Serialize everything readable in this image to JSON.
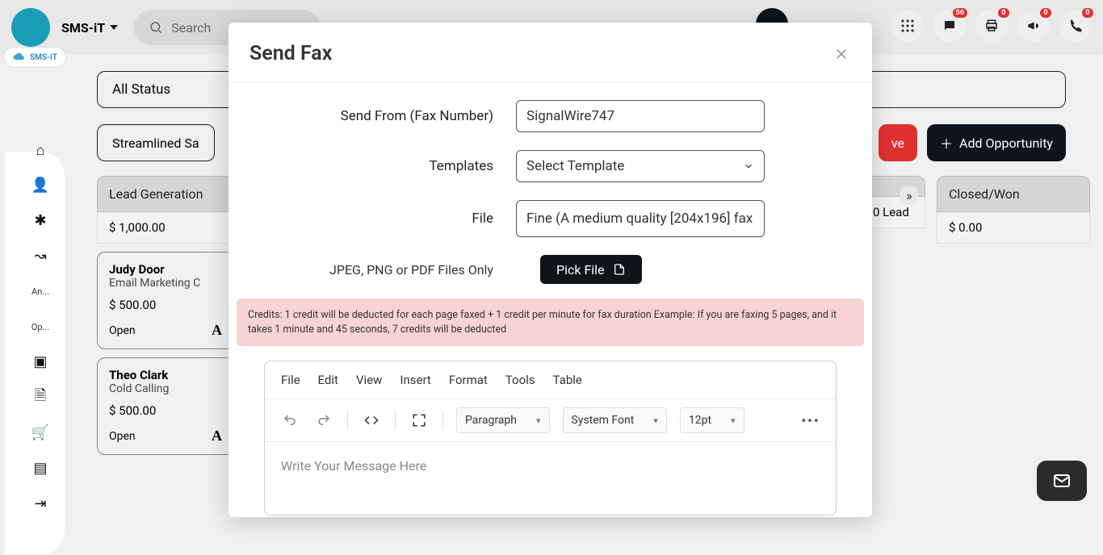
{
  "header": {
    "brand": "SMS-iT",
    "search_placeholder": "Search",
    "badges": {
      "chat": "56",
      "print": "0",
      "announce": "0",
      "phone": "0"
    }
  },
  "rail": {
    "logo": "SMS-iT",
    "items": [
      {
        "label": ""
      },
      {
        "label": ""
      },
      {
        "label": ""
      },
      {
        "label": ""
      },
      {
        "label": "An..."
      },
      {
        "label": "Op..."
      },
      {
        "label": ""
      },
      {
        "label": ""
      },
      {
        "label": ""
      },
      {
        "label": ""
      },
      {
        "label": ""
      }
    ]
  },
  "filters": {
    "status": "All Status",
    "pipeline": "Streamlined Sa"
  },
  "buttons": {
    "delete_suffix": "ve",
    "add_opp": "Add Opportunity"
  },
  "columns": [
    {
      "title": "Lead Generation",
      "sub": "$ 1,000.00"
    },
    {
      "title": "",
      "sub": "0 Lead"
    },
    {
      "title": "Closed/Won",
      "sub": "$ 0.00"
    }
  ],
  "cards": [
    {
      "name": "Judy Door",
      "sub": "Email Marketing C",
      "amt": "$ 500.00",
      "status": "Open"
    },
    {
      "name": "Theo Clark",
      "sub": "Cold Calling",
      "amt": "$ 500.00",
      "status": "Open"
    }
  ],
  "modal": {
    "title": "Send Fax",
    "labels": {
      "from": "Send From (Fax Number)",
      "templates": "Templates",
      "file": "File"
    },
    "from_value": "SignalWire747",
    "template_placeholder": "Select Template",
    "file_value": "Fine (A medium quality [204x196] fax",
    "pick_hint": "JPEG, PNG or PDF Files Only",
    "pick_button": "Pick File",
    "credits": "Credits: 1 credit will be deducted for each page faxed + 1 credit per minute for fax duration Example: If you are faxing 5 pages, and it takes 1 minute and 45 seconds, 7 credits will be deducted",
    "editor": {
      "menus": [
        "File",
        "Edit",
        "View",
        "Insert",
        "Format",
        "Tools",
        "Table"
      ],
      "block": "Paragraph",
      "font": "System Font",
      "size": "12pt",
      "placeholder": "Write Your Message Here"
    }
  }
}
